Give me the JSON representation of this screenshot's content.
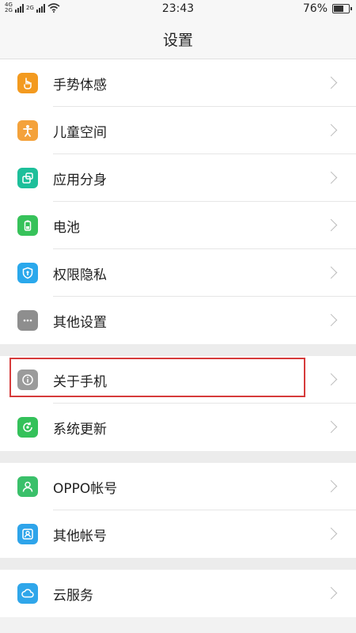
{
  "status_bar": {
    "network_1": "4G",
    "network_2": "2G",
    "network_3": "2G",
    "time": "23:43",
    "battery": "76%",
    "battery_level": 0.76
  },
  "header": {
    "title": "设置"
  },
  "groups": [
    {
      "items": [
        {
          "label": "手势体感",
          "icon": "gesture-icon",
          "color": "#f39a1f"
        },
        {
          "label": "儿童空间",
          "icon": "child-icon",
          "color": "#f4a23b"
        },
        {
          "label": "应用分身",
          "icon": "app-clone-icon",
          "color": "#1dbf9a"
        },
        {
          "label": "电池",
          "icon": "battery-icon",
          "color": "#37c25a"
        },
        {
          "label": "权限隐私",
          "icon": "privacy-shield-icon",
          "color": "#2aa8ec"
        },
        {
          "label": "其他设置",
          "icon": "more-icon",
          "color": "#8e8e8e"
        }
      ]
    },
    {
      "items": [
        {
          "label": "关于手机",
          "icon": "info-icon",
          "color": "#9b9b9b"
        },
        {
          "label": "系统更新",
          "icon": "update-icon",
          "color": "#34c15a"
        }
      ]
    },
    {
      "items": [
        {
          "label": "OPPO帐号",
          "icon": "user-icon",
          "color": "#3ac06a"
        },
        {
          "label": "其他帐号",
          "icon": "account-icon",
          "color": "#2ea4ea"
        }
      ]
    },
    {
      "items": [
        {
          "label": "云服务",
          "icon": "cloud-icon",
          "color": "#2fa6ea"
        }
      ]
    }
  ]
}
